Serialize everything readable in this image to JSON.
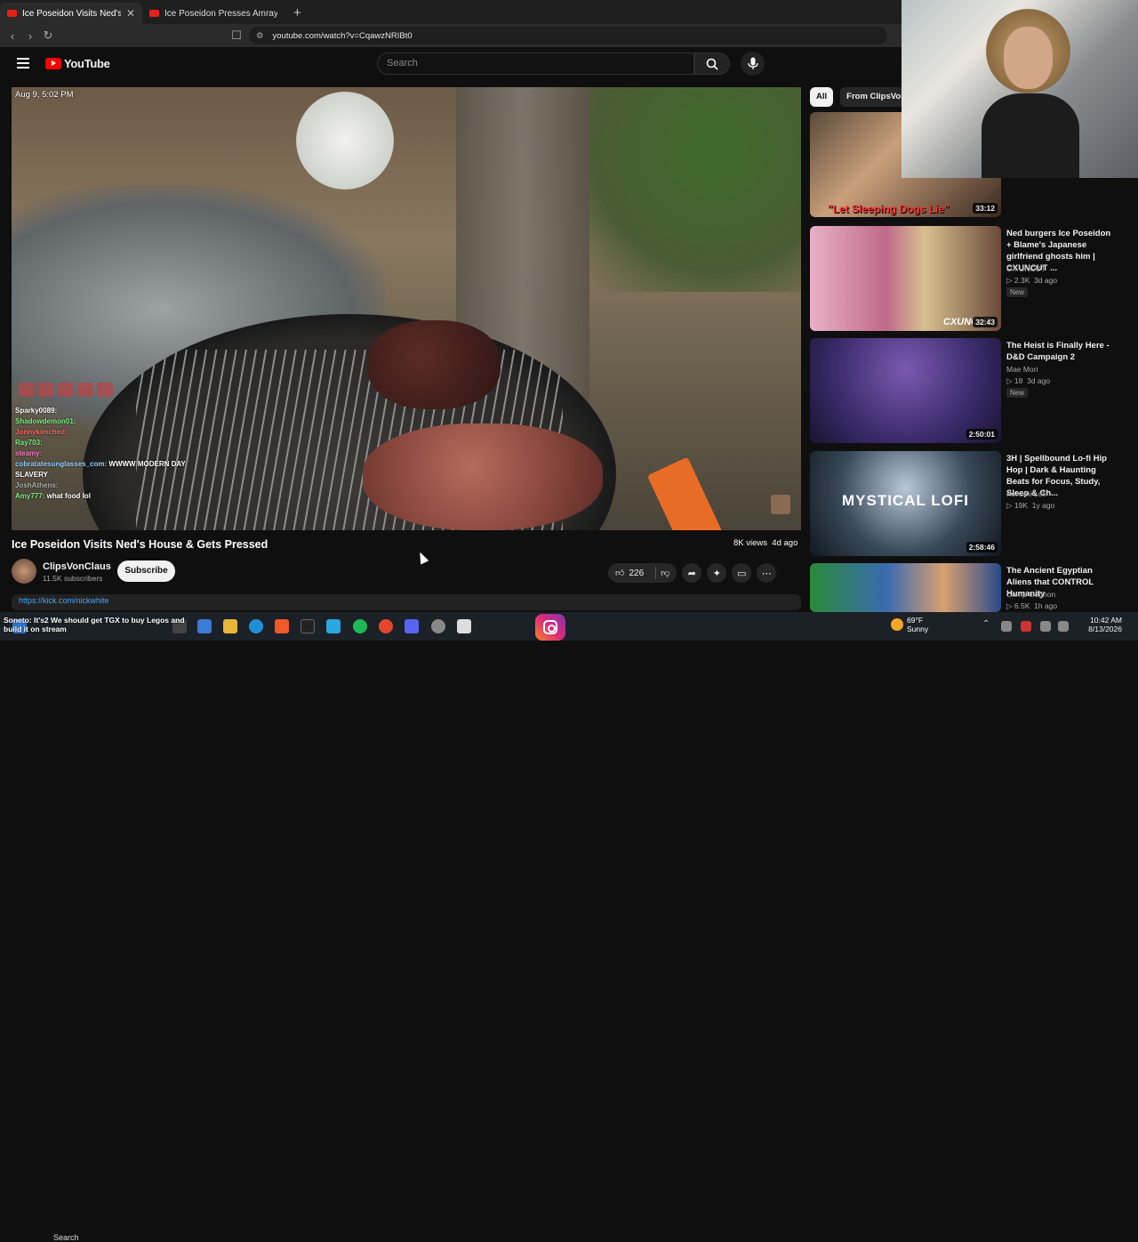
{
  "browser": {
    "tabs": [
      {
        "title": "Ice Poseidon Visits Ned's Hou"
      },
      {
        "title": "Ice Poseidon Presses Amray & Tries t"
      }
    ],
    "url": "youtube.com/watch?v=CqawzNRIBt0"
  },
  "header": {
    "logo": "YouTube",
    "search_placeholder": "Search"
  },
  "video": {
    "timestamp": "Aug 9, 5:02 PM",
    "chat": [
      {
        "user": "Sparky0089:",
        "msg": ""
      },
      {
        "user": "Shadowdemon01:",
        "msg": ""
      },
      {
        "user": "Jonnykimched:",
        "msg": ""
      },
      {
        "user": "Ray703:",
        "msg": ""
      },
      {
        "user": "steamy:",
        "msg": ""
      },
      {
        "user": "cobratatesunglasses_com:",
        "msg": "WWWW MODERN DAY"
      },
      {
        "user": "SLAVERY",
        "msg": ""
      },
      {
        "user": "JoshAthens:",
        "msg": ""
      },
      {
        "user": "Amy777:",
        "msg": "what food lol"
      }
    ],
    "title": "Ice Poseidon Visits Ned's House & Gets Pressed",
    "views": "8K views",
    "age": "4d ago",
    "channel": "ClipsVonClaus",
    "subscribers": "11.5K subscribers",
    "subscribe_label": "Subscribe",
    "likes": "226",
    "description_link": "https://kick.com/nickwhite"
  },
  "chips": [
    {
      "label": "All",
      "active": true
    },
    {
      "label": "From ClipsVonC",
      "active": false
    }
  ],
  "recommended": [
    {
      "title": "",
      "channel": "",
      "views": "",
      "age": "",
      "duration": "33:12",
      "overlay": "\"Let Sleeping Dogs Lie\"",
      "new": ""
    },
    {
      "title": "Ned burgers Ice Poseidon + Blame's Japanese girlfriend ghosts him | CXUNCUT ...",
      "channel": "CX UNCUT",
      "views": "2.3K",
      "age": "3d ago",
      "duration": "32:43",
      "overlay": "CXUNCUT",
      "new": "New"
    },
    {
      "title": "The Heist is Finally Here - D&D Campaign 2",
      "channel": "Mae Mori",
      "views": "18",
      "age": "3d ago",
      "duration": "2:50:01",
      "overlay": "",
      "new": "New"
    },
    {
      "title": "3H | Spellbound Lo-fi Hip Hop | Dark & Haunting Beats for Focus, Study, Sleep & Ch...",
      "channel": "Konbini Lofi",
      "views": "19K",
      "age": "1y ago",
      "duration": "2:58:46",
      "overlay": "MYSTICAL LOFI",
      "new": ""
    },
    {
      "title": "The Ancient Egyptian Aliens that CONTROL Humanity",
      "channel": "Camp Gagnon",
      "views": "6.5K",
      "age": "1h ago",
      "duration": "",
      "overlay": "",
      "new": ""
    }
  ],
  "overlay_chat": {
    "line1": "Soneto: It's2 We should get TGX to buy Legos and",
    "line2": "build it on stream"
  },
  "taskbar": {
    "search_label": "Search",
    "temperature": "69°F",
    "weather": "Sunny",
    "time": "10:42 AM",
    "date": "8/13/2026"
  },
  "colors": {
    "accent": "#ff0000",
    "background": "#0f0f0f",
    "link": "#3ea6ff"
  }
}
